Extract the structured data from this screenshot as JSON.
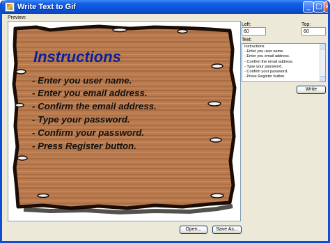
{
  "window": {
    "title": "Write Text to Gif",
    "icons": {
      "app": "app-icon",
      "minimize": "minimize-icon",
      "maximize": "maximize-icon",
      "close": "close-icon"
    }
  },
  "preview": {
    "label": "Preview:",
    "title": "Instructions",
    "lines": [
      "- Enter you user name.",
      "- Enter you email address.",
      "- Confirm the email address.",
      "- Type your password.",
      "- Confirm your password.",
      "- Press Register button."
    ]
  },
  "position": {
    "left_label": "Left:",
    "left_value": "60",
    "top_label": "Top:",
    "top_value": "60"
  },
  "text_box": {
    "label": "Text:",
    "lines": [
      "Instructions",
      "- Enter you user name.",
      "- Enter you email address.",
      "- Confirm the email address.",
      "- Type your password.",
      "- Confirm your password.",
      "- Press Register button."
    ]
  },
  "buttons": {
    "write": "Write",
    "open": "Open...",
    "save_as": "Save As..."
  }
}
